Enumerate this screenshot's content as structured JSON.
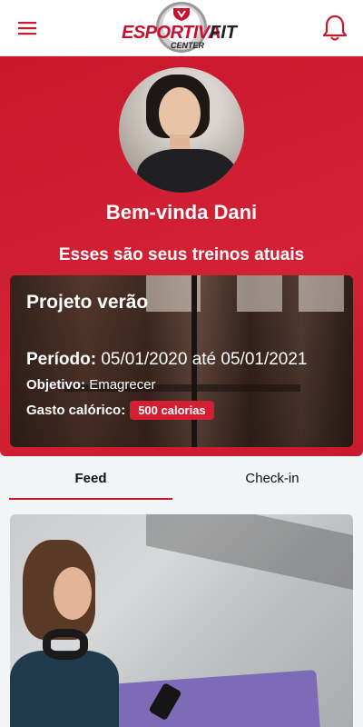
{
  "header": {
    "menu_icon": "hamburger-menu-icon",
    "logo": {
      "word_1": "ESPORTIVA",
      "word_2": "FIT",
      "word_3": "CENTER"
    },
    "notification_icon": "bell-icon",
    "accent_color": "#c8182a"
  },
  "hero": {
    "greeting": "Bem-vinda Dani",
    "subtitle": "Esses são seus treinos atuais",
    "background_color": "#d42136"
  },
  "workout": {
    "title": "Projeto verão",
    "period_label": "Período:",
    "period_value": "05/01/2020 até 05/01/2021",
    "objective_label": "Objetivo:",
    "objective_value": "Emagrecer",
    "calories_label": "Gasto calórico:",
    "calories_value": "500 calorias"
  },
  "tabs": [
    {
      "label": "Feed",
      "active": true
    },
    {
      "label": "Check-in",
      "active": false
    }
  ]
}
